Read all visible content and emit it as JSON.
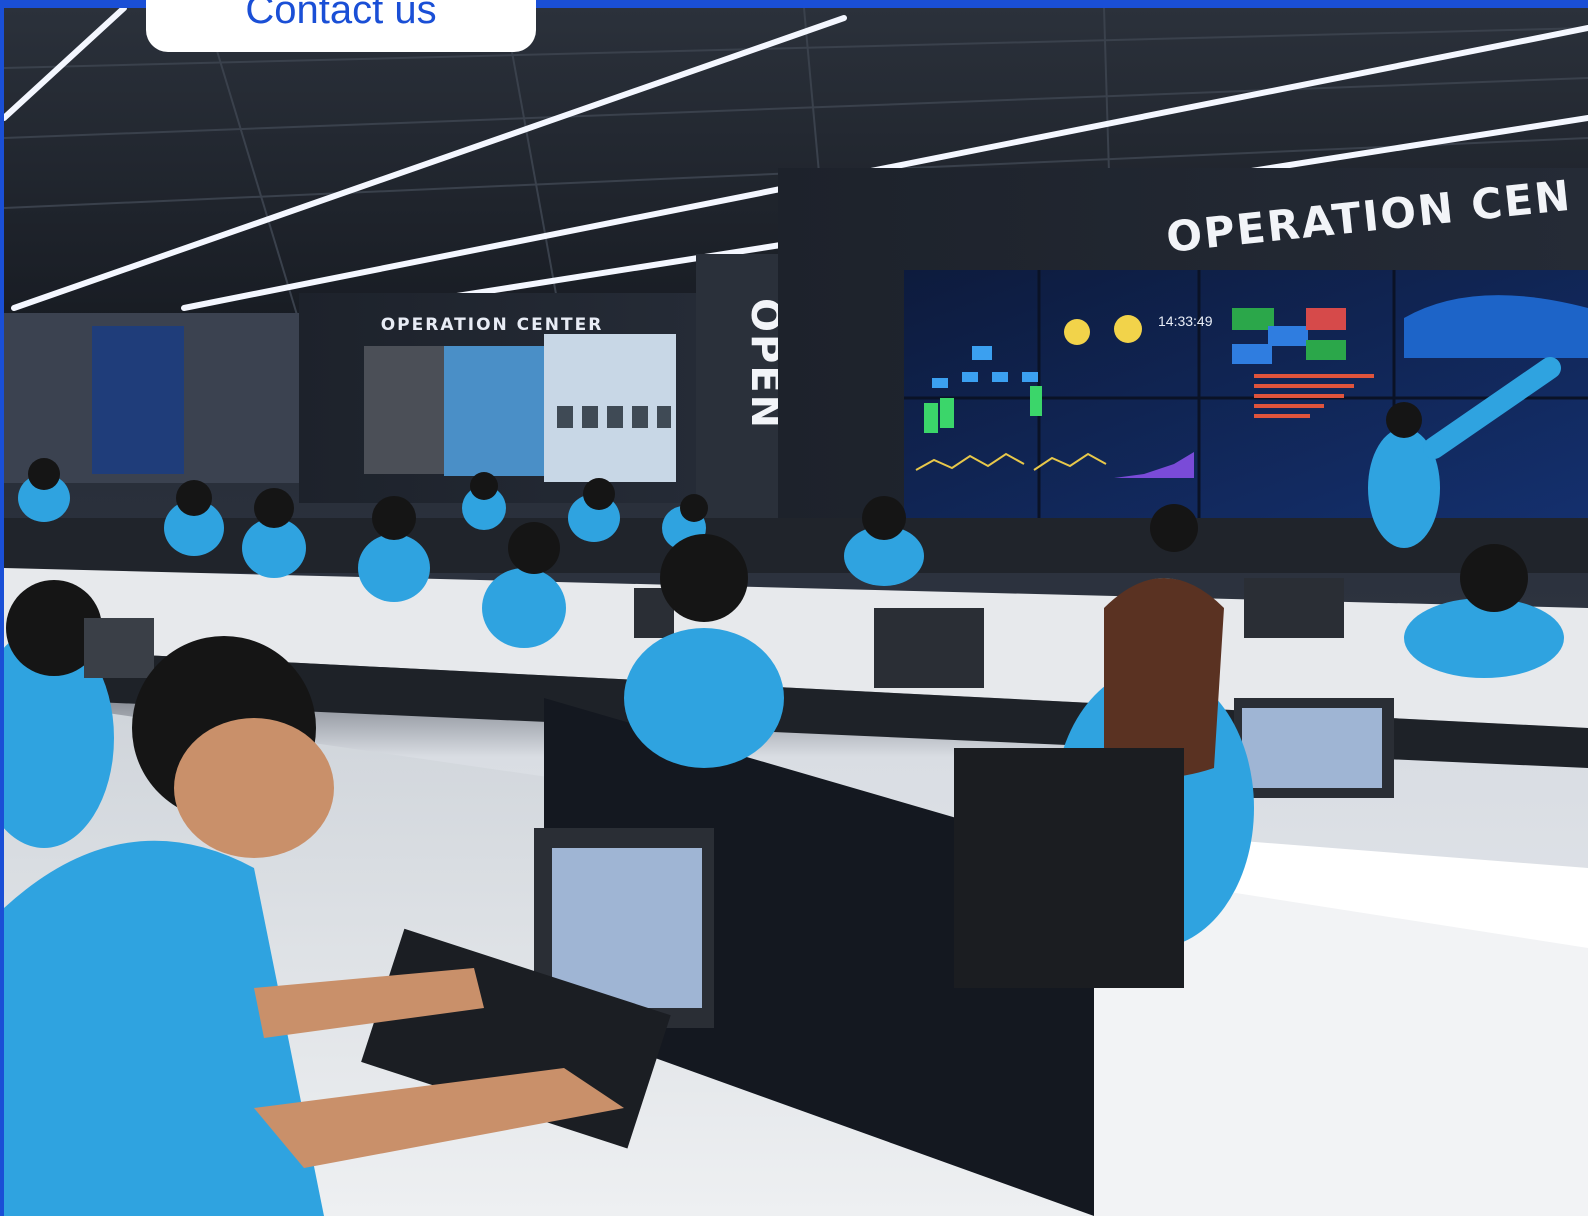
{
  "contact": {
    "label": "Contact us"
  },
  "photo": {
    "wall_sign": "OPERATION CEN",
    "small_sign": "OPERATION CENTER",
    "pillar_sign": "OPEN",
    "clock_time": "14:33:49"
  },
  "colors": {
    "brand_blue": "#1a4fd6",
    "button_bg": "#ffffff",
    "shirt_blue": "#2fa3e0"
  }
}
